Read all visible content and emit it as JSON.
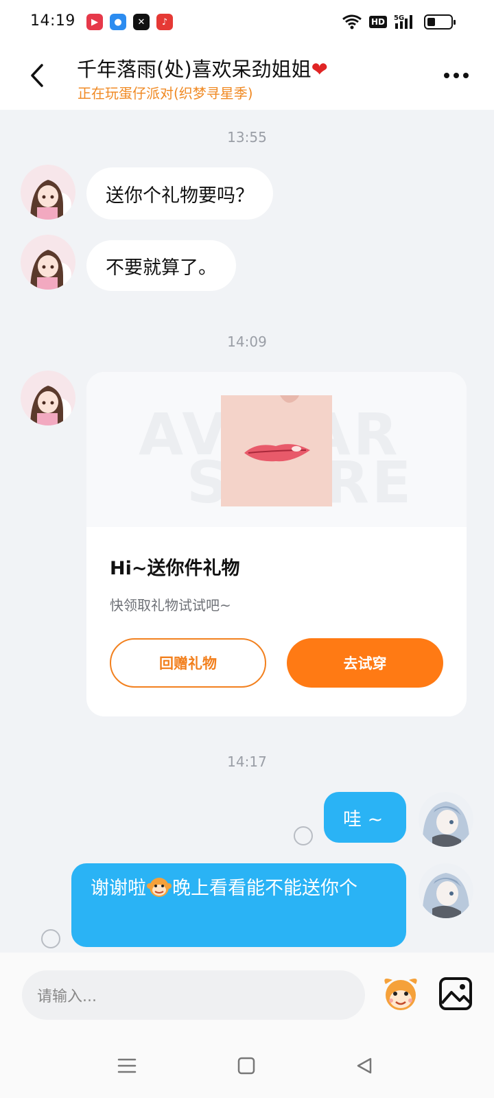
{
  "status_bar": {
    "time": "14:19",
    "hd_label": "HD",
    "network_label": "5G",
    "battery_level": 0.35
  },
  "header": {
    "title": "千年落雨(处)喜欢呆劲姐姐",
    "title_heart": "❤",
    "subtitle": "正在玩蛋仔派对(织梦寻星季)"
  },
  "chat": {
    "timestamps": [
      "13:55",
      "14:09",
      "14:17"
    ],
    "incoming": [
      {
        "text": "送你个礼物要吗？"
      },
      {
        "text": "不要就算了。"
      }
    ],
    "gift_card": {
      "watermark_top": "AVATAR",
      "watermark_bottom": "STORE",
      "title": "Hi~送你件礼物",
      "description": "快领取礼物试试吧~",
      "return_gift_label": "回赠礼物",
      "try_on_label": "去试穿"
    },
    "outgoing": [
      {
        "text": "哇 ~"
      },
      {
        "text_before": "谢谢啦",
        "text_after": "晚上看看能不能送你个"
      }
    ]
  },
  "composer": {
    "placeholder": "请输入..."
  },
  "colors": {
    "accent_orange": "#ff7a14",
    "outgoing_bubble": "#2ab3f5",
    "subtitle_orange": "#f08a24",
    "background": "#f1f3f6"
  }
}
